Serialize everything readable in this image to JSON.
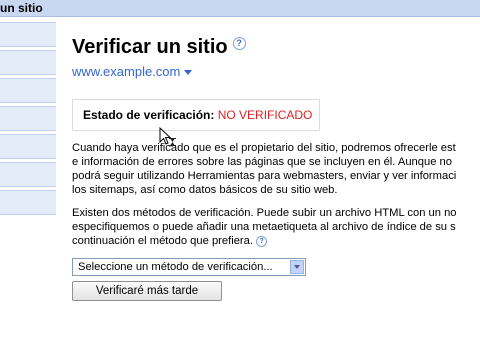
{
  "header": {
    "title": "un sitio"
  },
  "sidebar": {
    "items": [
      {},
      {},
      {},
      {},
      {},
      {},
      {}
    ]
  },
  "main": {
    "title": "Verificar un sitio",
    "help_icon": "help-icon",
    "site_url": "www.example.com",
    "status": {
      "label": "Estado de verificación:",
      "value": "NO VERIFICADO"
    },
    "paragraph1": [
      "Cuando haya verificado que es el propietario del sitio, podremos ofrecerle est",
      "e información de errores sobre las páginas que se incluyen en él. Aunque no",
      "podrá seguir utilizando Herramientas para webmasters, enviar y ver informaci",
      "los sitemaps, así como datos básicos de su sitio web."
    ],
    "paragraph2": [
      "Existen dos métodos de verificación. Puede subir un archivo HTML con un no",
      "especifiquemos o puede añadir una metaetiqueta al archivo de índice de su s",
      "continuación el método que prefiera."
    ],
    "method_select": {
      "value": "Seleccione un método de verificación..."
    },
    "later_button": "Verificaré más tarde"
  },
  "colors": {
    "link": "#3366cc",
    "unverified": "#dd2222",
    "topbar": "#c9d7f1",
    "sidebar": "#e5ecf9"
  }
}
